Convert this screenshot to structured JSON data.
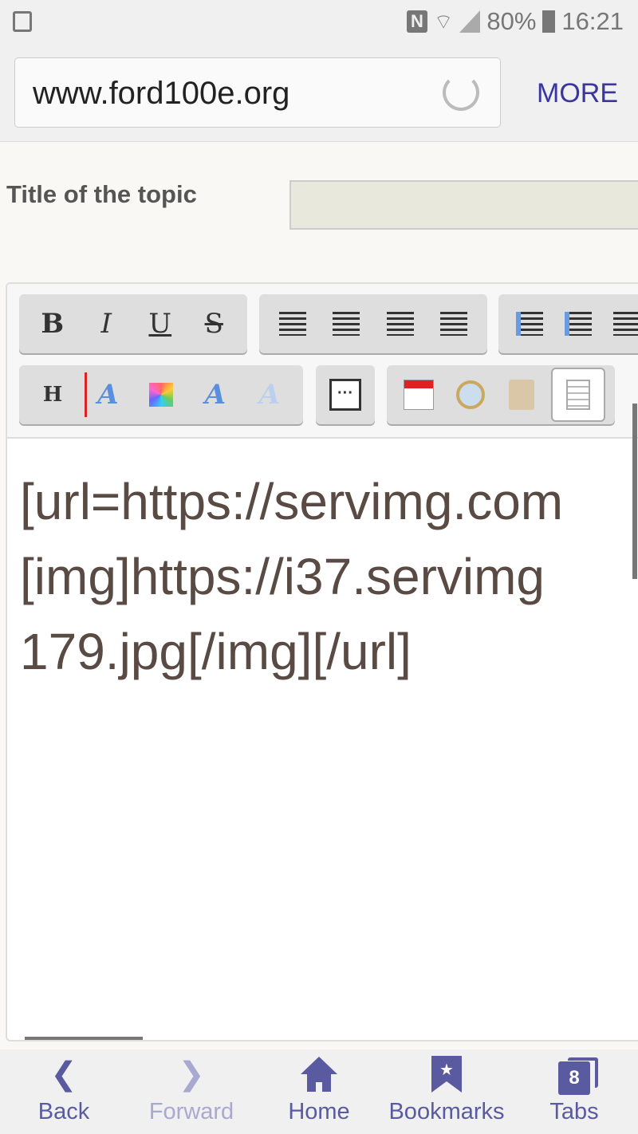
{
  "status_bar": {
    "battery": "80%",
    "time": "16:21",
    "icons": [
      "image-icon",
      "nfc-icon",
      "wifi-icon",
      "signal-icon",
      "battery-charging-icon"
    ]
  },
  "browser": {
    "url": "www.ford100e.org",
    "more_label": "MORE"
  },
  "form": {
    "title_label": "Title of the topic",
    "title_value": ""
  },
  "editor": {
    "toolbar_row1": [
      [
        "bold",
        "italic",
        "underline",
        "strikethrough"
      ],
      [
        "align-left",
        "align-center",
        "align-right",
        "justify"
      ],
      [
        "bullet-list",
        "numbered-list",
        "more-list"
      ]
    ],
    "toolbar_row2": [
      [
        "heading",
        "font-size",
        "color",
        "font",
        "remove-format"
      ],
      [
        "more"
      ],
      [
        "insert-date",
        "insert-time",
        "paste",
        "source-mode"
      ]
    ],
    "content_lines": [
      "[url=https://servimg.com",
      "[img]https://i37.servimg",
      "179.jpg[/img][/url]"
    ]
  },
  "nav": {
    "back": "Back",
    "forward": "Forward",
    "home": "Home",
    "bookmarks": "Bookmarks",
    "tabs": "Tabs",
    "tab_count": "8"
  },
  "colors": {
    "accent": "#5a5aa0",
    "more": "#3b35a0",
    "text": "#5a4a44"
  }
}
